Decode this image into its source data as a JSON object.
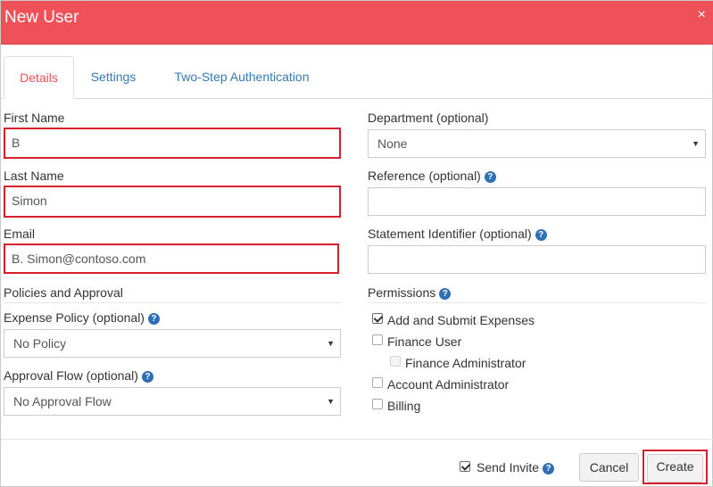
{
  "dialog": {
    "title": "New User",
    "close_glyph": "×"
  },
  "tabs": [
    {
      "label": "Details",
      "active": true
    },
    {
      "label": "Settings",
      "active": false
    },
    {
      "label": "Two-Step Authentication",
      "active": false
    }
  ],
  "form": {
    "first_name": {
      "label": "First Name",
      "value": "B"
    },
    "last_name": {
      "label": "Last Name",
      "value": "Simon"
    },
    "email": {
      "label": "Email",
      "value": "B. Simon@contoso.com"
    },
    "department": {
      "label": "Department (optional)",
      "value": "None"
    },
    "reference": {
      "label": "Reference (optional)",
      "value": ""
    },
    "statement_identifier": {
      "label": "Statement Identifier (optional)",
      "value": ""
    },
    "policies_section": "Policies and Approval",
    "expense_policy": {
      "label": "Expense Policy (optional)",
      "value": "No Policy"
    },
    "approval_flow": {
      "label": "Approval Flow (optional)",
      "value": "No Approval Flow"
    },
    "permissions": {
      "label": "Permissions",
      "items": [
        {
          "label": "Add and Submit Expenses",
          "checked": true,
          "disabled": false
        },
        {
          "label": "Finance User",
          "checked": false,
          "disabled": false
        },
        {
          "label": "Finance Administrator",
          "checked": false,
          "disabled": true
        },
        {
          "label": "Account Administrator",
          "checked": false,
          "disabled": false
        },
        {
          "label": "Billing",
          "checked": false,
          "disabled": false
        }
      ]
    }
  },
  "footer": {
    "send_invite": {
      "label": "Send Invite",
      "checked": true
    },
    "cancel_label": "Cancel",
    "create_label": "Create"
  },
  "icons": {
    "help": "question-circle-icon",
    "dropdown": "caret-down-icon",
    "close": "close-icon"
  },
  "colors": {
    "header": "#ef5158",
    "active_tab": "#ef5158",
    "link": "#337ab7",
    "highlight": "#d6202b",
    "help_icon": "#2f6fb5"
  }
}
